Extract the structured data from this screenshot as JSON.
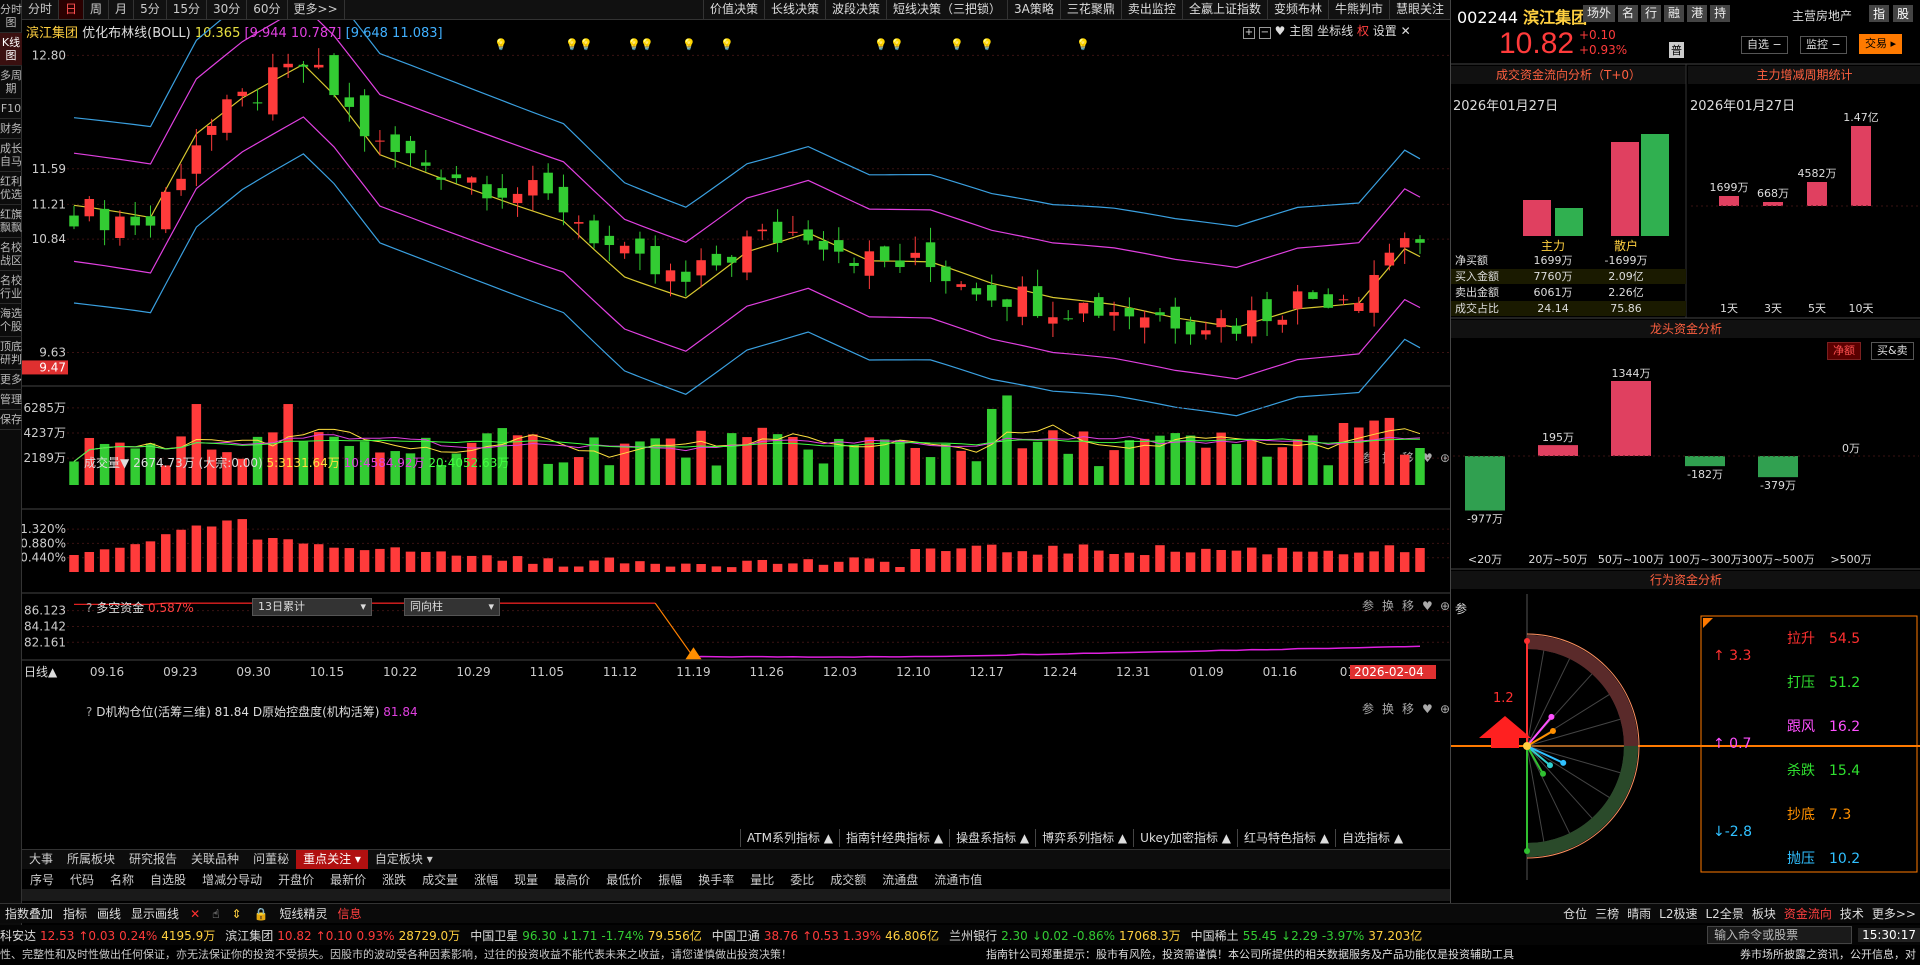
{
  "left_sidebar": [
    "分时图",
    "K线图",
    "多周期",
    "F10",
    "财务",
    "成长自马",
    "红利优选",
    "红旗飘飘",
    "名校战区",
    "名校行业",
    "海选个股",
    "顶底研判",
    "更多",
    "管理",
    "保存"
  ],
  "period_tabs": [
    "分时",
    "日",
    "周",
    "月",
    "5分",
    "15分",
    "30分",
    "60分",
    "更多>>"
  ],
  "top_right_tabs": [
    "价值决策",
    "长线决策",
    "波段决策",
    "短线决策（三把锁）",
    "3A策略",
    "三花聚鼎",
    "卖出监控",
    "全嬴上证指数",
    "变频布林",
    "牛熊判市",
    "慧眼关注"
  ],
  "indicator_line": {
    "name": "滨江集团",
    "indicator": "优化布林线(BOLL)",
    "mid": "10.365",
    "band1": "[9.944 10.787]",
    "band2": "[9.648 11.083]"
  },
  "chart_toolbar": {
    "main_label": "主图",
    "coord_label": "坐标线",
    "fq_label": "权",
    "settings_label": "设置"
  },
  "price_axis": [
    "12.80",
    "11.59",
    "11.21",
    "10.84",
    "9.63"
  ],
  "price_low_label": "9.47",
  "volume_header": {
    "name": "成交量▼",
    "total": "2674.73万",
    "dazong": "(大宗:0.00)",
    "ma5": "5:3131.64万",
    "ma10": "10:4584.92万",
    "ma20": "20:4052.63万"
  },
  "volume_axis": [
    "6285万",
    "4237万",
    "2189万"
  ],
  "duokong_header": {
    "name": "多空资金",
    "value": "0.587%",
    "dropdown1": "13日累计",
    "dropdown2": "同向柱"
  },
  "duokong_axis": [
    "1.320%",
    "0.880%",
    "0.440%"
  ],
  "inst_header": {
    "name": "D机构仓位(活筹三维)",
    "value1": "81.84",
    "name2": "D原始控盘度(机构活筹)",
    "value2": "81.84"
  },
  "inst_axis": [
    "86.123",
    "84.142",
    "82.161"
  ],
  "panel_tools": [
    "参",
    "换",
    "移"
  ],
  "date_axis_label": "日线▲",
  "dates": [
    "09.16",
    "09.23",
    "09.30",
    "10.15",
    "10.22",
    "10.29",
    "11.05",
    "11.12",
    "11.19",
    "11.26",
    "12.03",
    "12.10",
    "12.17",
    "12.24",
    "12.31",
    "01.09",
    "01.16",
    "01.2"
  ],
  "date_cursor": "2026-02-04",
  "indicator_menus": [
    "ATM系列指标 ▲",
    "指南针经典指标 ▲",
    "操盘系指标 ▲",
    "博弈系列指标 ▲",
    "Ukey加密指标 ▲",
    "红马特色指标 ▲",
    "自选指标 ▲"
  ],
  "bottom_tabs": [
    "大事",
    "所属板块",
    "研究报告",
    "关联品种",
    "问董秘",
    "重点关注",
    "自定板块"
  ],
  "column_headers": [
    "序号",
    "代码",
    "名称",
    "自选股",
    "增减分导动",
    "开盘价",
    "最新价",
    "涨跌",
    "成交量",
    "涨幅",
    "现量",
    "最高价",
    "最低价",
    "振幅",
    "换手率",
    "量比",
    "委比",
    "成交额",
    "流通盘",
    "流通市值"
  ],
  "status_tools": [
    "指数叠加",
    "指标",
    "画线",
    "显示画线",
    "短线精灵",
    "信息"
  ],
  "right_tabs": [
    "L2极速",
    "L2全景",
    "",
    "板块",
    "资金流向",
    "技术",
    "更多>>"
  ],
  "right_tabs2": [
    "仓位",
    "三榜",
    "晴雨"
  ],
  "ticker": [
    {
      "name": "科安达",
      "price": "12.53",
      "chg": "↑0.03",
      "pct": "0.24%",
      "amt": "4195.9万",
      "up": true
    },
    {
      "name": "滨江集团",
      "price": "10.82",
      "chg": "↑0.10",
      "pct": "0.93%",
      "amt": "28729.0万",
      "up": true
    },
    {
      "name": "中国卫星",
      "price": "96.30",
      "chg": "↓1.71",
      "pct": "-1.74%",
      "amt": "79.556亿",
      "up": false
    },
    {
      "name": "中国卫通",
      "price": "38.76",
      "chg": "↑0.53",
      "pct": "1.39%",
      "amt": "46.806亿",
      "up": true
    },
    {
      "name": "兰州银行",
      "price": "2.30",
      "chg": "↓0.02",
      "pct": "-0.86%",
      "amt": "17068.3万",
      "up": false
    },
    {
      "name": "中国稀土",
      "price": "55.45",
      "chg": "↓2.29",
      "pct": "-3.97%",
      "amt": "37.203亿",
      "up": false
    }
  ],
  "cmd_input": "输入命令或股票",
  "clock": "15:30:17",
  "warning": "性、完整性和及时性做出任何保证，亦无法保证你的投资不受损失。因股市的波动受各种因素影响，过往的投资收益不能代表未来之收益，请您谨慎做出投资决策！",
  "warning2": "指南针公司郑重提示：股市有风险，投资需谨慎！本公司所提供的相关数据服务及产品功能仅是投资辅助工具",
  "warning3": "券市场所披露之资讯，公开信息，对",
  "stock": {
    "code": "002244",
    "name": "滨江集团",
    "tags": [
      "场外",
      "名",
      "行",
      "融",
      "港",
      "持"
    ],
    "industry": "主营房地产",
    "idx": "指",
    "gu": "股",
    "price": "10.82",
    "chg": "+0.10",
    "pct": "+0.93%",
    "reg": "普",
    "zixuan": "自选",
    "jiankong": "监控",
    "jiaoyi": "交易"
  },
  "flow": {
    "title": "成交资金流向分析（T+0）",
    "date": "2026年01月27日",
    "labels": [
      "主力",
      "散户"
    ],
    "rows": [
      [
        "净买额",
        "1699万",
        "-1699万"
      ],
      [
        "买入金额",
        "7760万",
        "2.09亿"
      ],
      [
        "卖出金额",
        "6061万",
        "2.26亿"
      ],
      [
        "成交占比",
        "24.14",
        "75.86"
      ]
    ]
  },
  "zl": {
    "title": "主力增减周期统计",
    "date": "2026年01月27日",
    "periods": [
      "1天",
      "3天",
      "5天",
      "10天"
    ],
    "values": [
      "1699万",
      "668万",
      "4582万",
      "1.47亿"
    ]
  },
  "longtou": {
    "title": "龙头资金分析",
    "btn1": "净额",
    "btn2": "买&卖",
    "cats": [
      "<20万",
      "20万~50万",
      "50万~100万",
      "100万~300万",
      "300万~500万",
      ">500万"
    ],
    "values": [
      "-977万",
      "195万",
      "1344万",
      "-182万",
      "-379万",
      "0万"
    ]
  },
  "behavior": {
    "title": "行为资金分析",
    "side": "参",
    "arrow_val": "1.2",
    "legend": [
      {
        "k": "拉升",
        "v": "54.5"
      },
      {
        "k": "打压",
        "v": "51.2"
      },
      {
        "k": "跟风",
        "v": "16.2"
      },
      {
        "k": "杀跌",
        "v": "15.4"
      },
      {
        "k": "抄底",
        "v": "7.3"
      },
      {
        "k": "抛压",
        "v": "10.2"
      }
    ],
    "left": [
      "↑ 3.3",
      "↑ 0.7",
      "↓-2.8"
    ]
  },
  "colors": {
    "up": "#ff3b3b",
    "down": "#33cc33",
    "bg": "#000000",
    "grid": "#3a1212"
  }
}
